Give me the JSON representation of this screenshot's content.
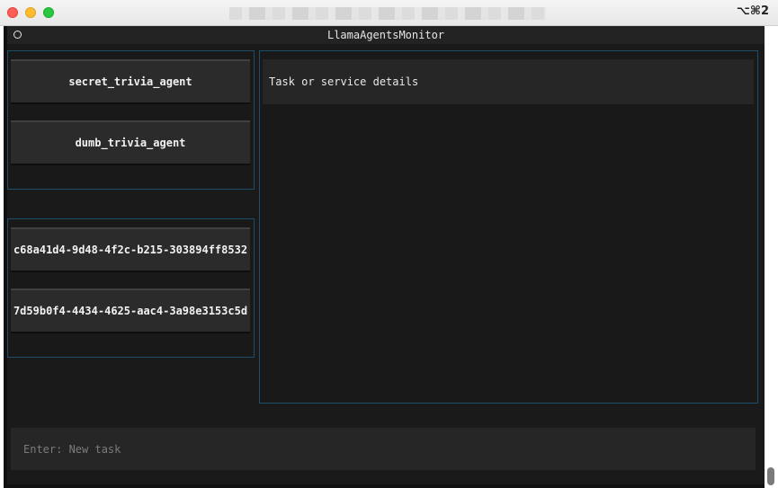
{
  "window": {
    "shortcut": "⌥⌘2"
  },
  "app": {
    "title": "LlamaAgentsMonitor"
  },
  "agents": [
    {
      "label": "secret_trivia_agent"
    },
    {
      "label": "dumb_trivia_agent"
    }
  ],
  "tasks": [
    {
      "label": "c68a41d4-9d48-4f2c-b215-303894ff8532"
    },
    {
      "label": "7d59b0f4-4434-4625-aac4-3a98e3153c5d"
    }
  ],
  "details": {
    "text": "Task or service details"
  },
  "task_input": {
    "placeholder": "Enter: New task",
    "value": ""
  },
  "colors": {
    "panel_border": "#1d4f6b",
    "background": "#1a1a1a",
    "button": "#2b2b2b"
  }
}
